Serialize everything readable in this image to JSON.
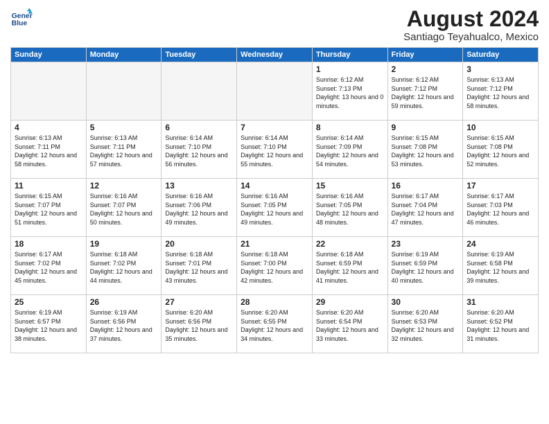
{
  "logo": {
    "line1": "General",
    "line2": "Blue"
  },
  "title": "August 2024",
  "location": "Santiago Teyahualco, Mexico",
  "days_of_week": [
    "Sunday",
    "Monday",
    "Tuesday",
    "Wednesday",
    "Thursday",
    "Friday",
    "Saturday"
  ],
  "weeks": [
    [
      {
        "day": "",
        "empty": true
      },
      {
        "day": "",
        "empty": true
      },
      {
        "day": "",
        "empty": true
      },
      {
        "day": "",
        "empty": true
      },
      {
        "day": "1",
        "sunrise": "6:12 AM",
        "sunset": "7:13 PM",
        "daylight": "13 hours and 0 minutes."
      },
      {
        "day": "2",
        "sunrise": "6:12 AM",
        "sunset": "7:12 PM",
        "daylight": "12 hours and 59 minutes."
      },
      {
        "day": "3",
        "sunrise": "6:13 AM",
        "sunset": "7:12 PM",
        "daylight": "12 hours and 58 minutes."
      }
    ],
    [
      {
        "day": "4",
        "sunrise": "6:13 AM",
        "sunset": "7:11 PM",
        "daylight": "12 hours and 58 minutes."
      },
      {
        "day": "5",
        "sunrise": "6:13 AM",
        "sunset": "7:11 PM",
        "daylight": "12 hours and 57 minutes."
      },
      {
        "day": "6",
        "sunrise": "6:14 AM",
        "sunset": "7:10 PM",
        "daylight": "12 hours and 56 minutes."
      },
      {
        "day": "7",
        "sunrise": "6:14 AM",
        "sunset": "7:10 PM",
        "daylight": "12 hours and 55 minutes."
      },
      {
        "day": "8",
        "sunrise": "6:14 AM",
        "sunset": "7:09 PM",
        "daylight": "12 hours and 54 minutes."
      },
      {
        "day": "9",
        "sunrise": "6:15 AM",
        "sunset": "7:08 PM",
        "daylight": "12 hours and 53 minutes."
      },
      {
        "day": "10",
        "sunrise": "6:15 AM",
        "sunset": "7:08 PM",
        "daylight": "12 hours and 52 minutes."
      }
    ],
    [
      {
        "day": "11",
        "sunrise": "6:15 AM",
        "sunset": "7:07 PM",
        "daylight": "12 hours and 51 minutes."
      },
      {
        "day": "12",
        "sunrise": "6:16 AM",
        "sunset": "7:07 PM",
        "daylight": "12 hours and 50 minutes."
      },
      {
        "day": "13",
        "sunrise": "6:16 AM",
        "sunset": "7:06 PM",
        "daylight": "12 hours and 49 minutes."
      },
      {
        "day": "14",
        "sunrise": "6:16 AM",
        "sunset": "7:05 PM",
        "daylight": "12 hours and 49 minutes."
      },
      {
        "day": "15",
        "sunrise": "6:16 AM",
        "sunset": "7:05 PM",
        "daylight": "12 hours and 48 minutes."
      },
      {
        "day": "16",
        "sunrise": "6:17 AM",
        "sunset": "7:04 PM",
        "daylight": "12 hours and 47 minutes."
      },
      {
        "day": "17",
        "sunrise": "6:17 AM",
        "sunset": "7:03 PM",
        "daylight": "12 hours and 46 minutes."
      }
    ],
    [
      {
        "day": "18",
        "sunrise": "6:17 AM",
        "sunset": "7:02 PM",
        "daylight": "12 hours and 45 minutes."
      },
      {
        "day": "19",
        "sunrise": "6:18 AM",
        "sunset": "7:02 PM",
        "daylight": "12 hours and 44 minutes."
      },
      {
        "day": "20",
        "sunrise": "6:18 AM",
        "sunset": "7:01 PM",
        "daylight": "12 hours and 43 minutes."
      },
      {
        "day": "21",
        "sunrise": "6:18 AM",
        "sunset": "7:00 PM",
        "daylight": "12 hours and 42 minutes."
      },
      {
        "day": "22",
        "sunrise": "6:18 AM",
        "sunset": "6:59 PM",
        "daylight": "12 hours and 41 minutes."
      },
      {
        "day": "23",
        "sunrise": "6:19 AM",
        "sunset": "6:59 PM",
        "daylight": "12 hours and 40 minutes."
      },
      {
        "day": "24",
        "sunrise": "6:19 AM",
        "sunset": "6:58 PM",
        "daylight": "12 hours and 39 minutes."
      }
    ],
    [
      {
        "day": "25",
        "sunrise": "6:19 AM",
        "sunset": "6:57 PM",
        "daylight": "12 hours and 38 minutes."
      },
      {
        "day": "26",
        "sunrise": "6:19 AM",
        "sunset": "6:56 PM",
        "daylight": "12 hours and 37 minutes."
      },
      {
        "day": "27",
        "sunrise": "6:20 AM",
        "sunset": "6:56 PM",
        "daylight": "12 hours and 35 minutes."
      },
      {
        "day": "28",
        "sunrise": "6:20 AM",
        "sunset": "6:55 PM",
        "daylight": "12 hours and 34 minutes."
      },
      {
        "day": "29",
        "sunrise": "6:20 AM",
        "sunset": "6:54 PM",
        "daylight": "12 hours and 33 minutes."
      },
      {
        "day": "30",
        "sunrise": "6:20 AM",
        "sunset": "6:53 PM",
        "daylight": "12 hours and 32 minutes."
      },
      {
        "day": "31",
        "sunrise": "6:20 AM",
        "sunset": "6:52 PM",
        "daylight": "12 hours and 31 minutes."
      }
    ]
  ]
}
